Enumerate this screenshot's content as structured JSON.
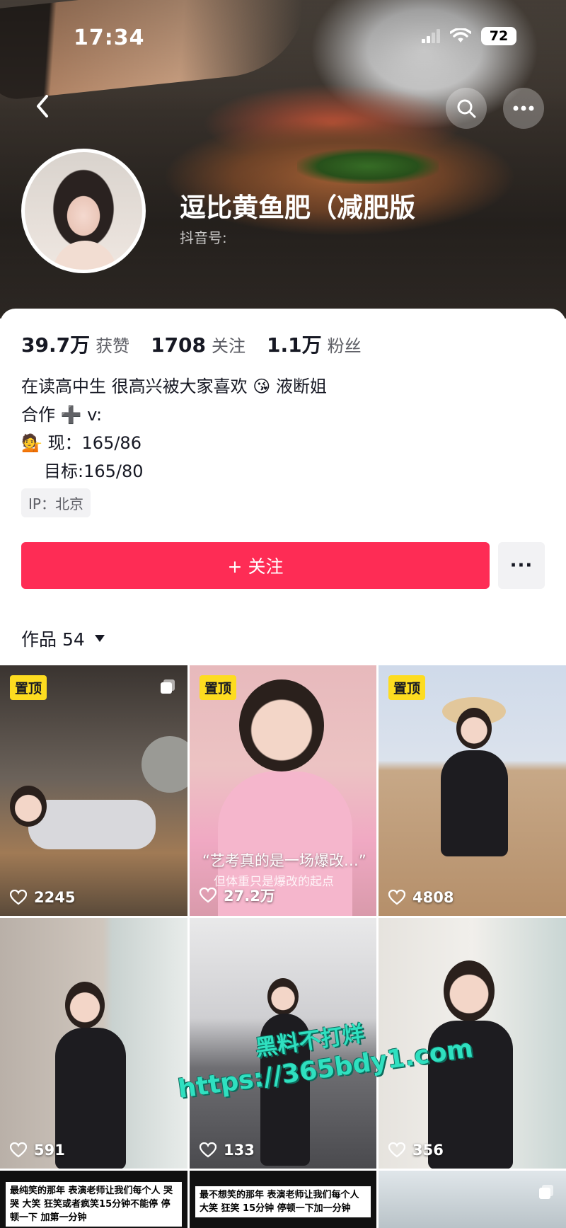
{
  "status_bar": {
    "time": "17:34",
    "battery": "72"
  },
  "header": {
    "nickname": "逗比黄鱼肥（减肥版",
    "douyin_id_label": "抖音号:"
  },
  "stats": [
    {
      "value": "39.7万",
      "label": "获赞"
    },
    {
      "value": "1708",
      "label": "关注"
    },
    {
      "value": "1.1万",
      "label": "粉丝"
    }
  ],
  "bio": {
    "line1_a": "在读高中生 很高兴被大家喜欢",
    "line1_b": "液断姐",
    "line2": "合作 ➕ v:",
    "line3": "现：165/86",
    "line4": "目标:165/80",
    "emoji_kiss": "😘",
    "emoji_person": "💁"
  },
  "ip": "IP：北京",
  "actions": {
    "follow_label": "+ 关注",
    "more_label": "···"
  },
  "works": {
    "tab_label": "作品 54"
  },
  "videos": [
    {
      "pinned_label": "置顶",
      "likes": "2245"
    },
    {
      "pinned_label": "置顶",
      "likes": "27.2万",
      "caption": "“艺考真的是一场爆改…”",
      "subcaption": "但体重只是爆改的起点"
    },
    {
      "pinned_label": "置顶",
      "likes": "4808"
    },
    {
      "likes": "591"
    },
    {
      "likes": "133"
    },
    {
      "likes": "356"
    },
    {
      "overlay_text": "最纯笑的那年 表演老师让我们每个人 哭哭 大笑 狂笑或者疯笑15分钟不能停 停顿一下 加第一分钟"
    },
    {
      "overlay_text": "最不想笑的那年 表演老师让我们每个人 大笑 狂笑 15分钟 停顿一下加一分钟"
    },
    {}
  ],
  "watermark": {
    "line1": "黑料不打烊",
    "line2": "https://365bdy1.com"
  },
  "colors": {
    "accent": "#fe2c55",
    "pin": "#fddc20",
    "watermark": "#2fe0c0"
  }
}
